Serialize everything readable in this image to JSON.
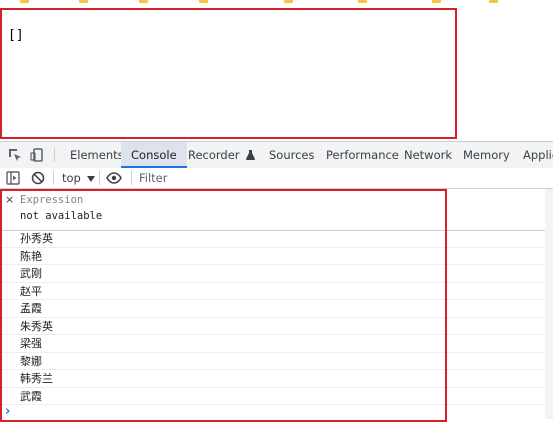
{
  "page": {
    "content": "[]"
  },
  "devtools": {
    "tabs": [
      {
        "label": "Elements",
        "active": false
      },
      {
        "label": "Console",
        "active": true
      },
      {
        "label": "Recorder",
        "active": false
      },
      {
        "label": "Sources",
        "active": false
      },
      {
        "label": "Performance",
        "active": false
      },
      {
        "label": "Network",
        "active": false
      },
      {
        "label": "Memory",
        "active": false
      },
      {
        "label": "Applica",
        "active": false
      }
    ],
    "console_toolbar": {
      "context": "top",
      "filter_placeholder": "Filter"
    },
    "expression": {
      "close_glyph": "×",
      "placeholder": "Expression",
      "value": "not available"
    },
    "log_entries": [
      "孙秀英",
      "陈艳",
      "武刚",
      "赵平",
      "孟霞",
      "朱秀英",
      "梁强",
      "黎娜",
      "韩秀兰",
      "武霞"
    ],
    "prompt_glyph": "›"
  },
  "colors": {
    "highlight": "#d3202a",
    "accent": "#1a73e8",
    "folder": "#f4c542"
  }
}
